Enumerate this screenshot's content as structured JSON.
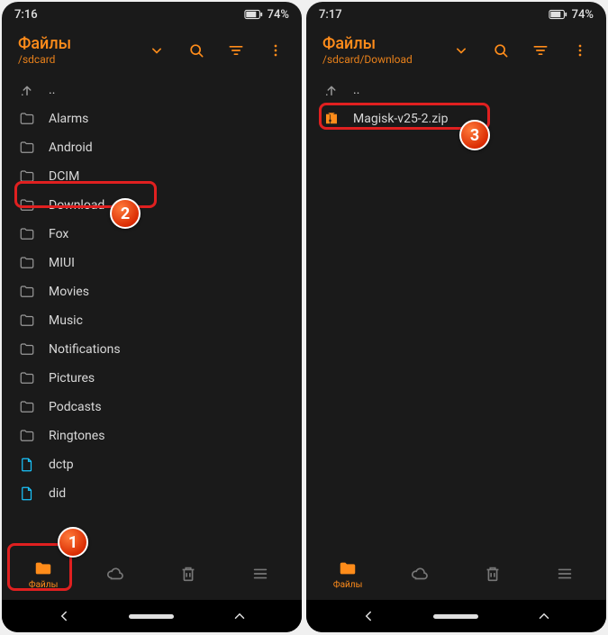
{
  "left": {
    "status": {
      "time": "7:16",
      "battery": "74%"
    },
    "header": {
      "title": "Файлы",
      "path": "/sdcard"
    },
    "up_label": "..",
    "items": [
      {
        "type": "folder",
        "name": "Alarms"
      },
      {
        "type": "folder",
        "name": "Android"
      },
      {
        "type": "folder",
        "name": "DCIM"
      },
      {
        "type": "folder",
        "name": "Download"
      },
      {
        "type": "folder",
        "name": "Fox"
      },
      {
        "type": "folder",
        "name": "MIUI"
      },
      {
        "type": "folder",
        "name": "Movies"
      },
      {
        "type": "folder",
        "name": "Music"
      },
      {
        "type": "folder",
        "name": "Notifications"
      },
      {
        "type": "folder",
        "name": "Pictures"
      },
      {
        "type": "folder",
        "name": "Podcasts"
      },
      {
        "type": "folder",
        "name": "Ringtones"
      },
      {
        "type": "file",
        "name": "dctp"
      },
      {
        "type": "file",
        "name": "did"
      }
    ],
    "tabs": {
      "files": "Файлы"
    }
  },
  "right": {
    "status": {
      "time": "7:17",
      "battery": "74%"
    },
    "header": {
      "title": "Файлы",
      "path": "/sdcard/Download"
    },
    "up_label": "..",
    "items": [
      {
        "type": "zip",
        "name": "Magisk-v25-2.zip"
      }
    ],
    "tabs": {
      "files": "Файлы"
    }
  },
  "annotations": {
    "b1": "1",
    "b2": "2",
    "b3": "3"
  }
}
